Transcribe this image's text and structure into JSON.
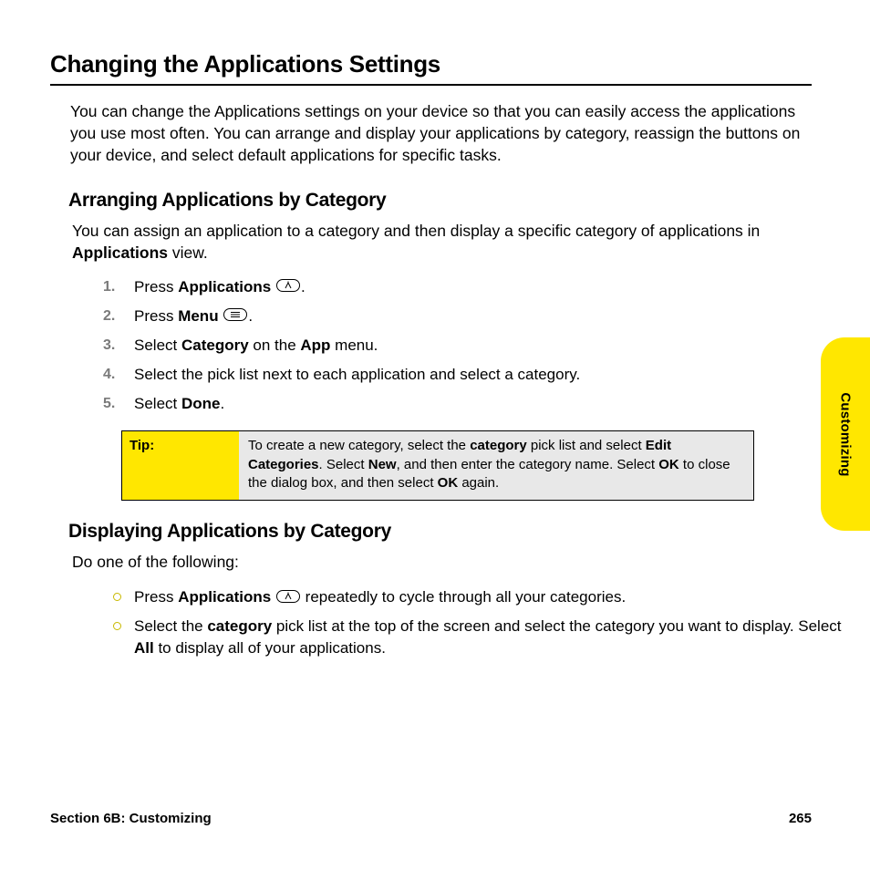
{
  "sideTab": "Customizing",
  "title": "Changing the Applications Settings",
  "intro": "You can change the Applications settings on your device so that you can easily access the applications you use most often. You can arrange and display your applications by category, reassign the buttons on your device, and select default applications for specific tasks.",
  "section1": {
    "heading": "Arranging Applications by Category",
    "lead_pre": "You can assign an application to a category and then display a specific category of applications in ",
    "lead_bold": "Applications",
    "lead_post": " view.",
    "steps": {
      "s1_pre": "Press ",
      "s1_bold": "Applications",
      "s2_pre": "Press ",
      "s2_bold": "Menu",
      "s3_pre": "Select ",
      "s3_b1": "Category",
      "s3_mid": " on the ",
      "s3_b2": "App",
      "s3_post": " menu.",
      "s4": "Select the pick list next to each application and select a category.",
      "s5_pre": "Select ",
      "s5_bold": "Done",
      "s5_post": "."
    },
    "tip": {
      "label": "Tip:",
      "t1": "To create a new category, select the ",
      "b1": "category",
      "t2": " pick list and select ",
      "b2": "Edit Categories",
      "t3": ". Select ",
      "b3": "New",
      "t4": ", and then enter the category name. Select ",
      "b4": "OK",
      "t5": " to close the dialog box, and  then select ",
      "b5": "OK",
      "t6": " again."
    }
  },
  "section2": {
    "heading": "Displaying Applications by Category",
    "lead": "Do one of the following:",
    "b1_pre": "Press ",
    "b1_bold": "Applications",
    "b1_post": " repeatedly to cycle through all your categories.",
    "b2_pre": "Select the ",
    "b2_b1": "category",
    "b2_mid": " pick list at the top of the screen and select the category you want to display. Select ",
    "b2_b2": "All",
    "b2_post": " to display all of your applications."
  },
  "footer": {
    "section": "Section 6B: Customizing",
    "page": "265"
  }
}
